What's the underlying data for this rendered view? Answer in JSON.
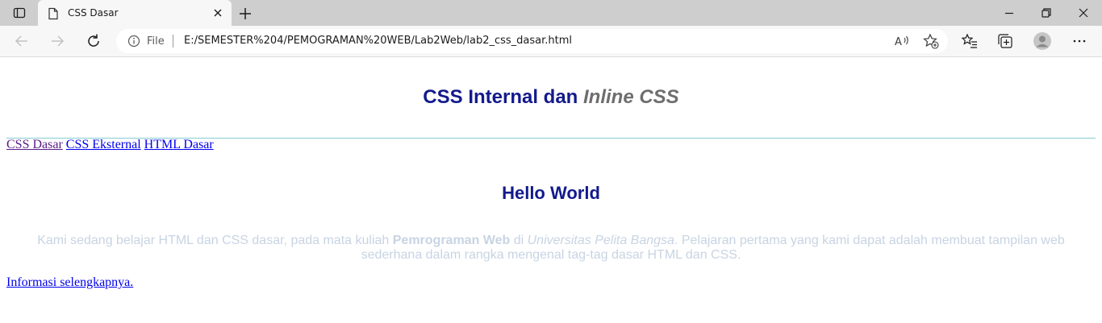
{
  "browser": {
    "tab_title": "CSS Dasar",
    "address_scheme_label": "File",
    "url": "E:/SEMESTER%204/PEMOGRAMAN%20WEB/Lab2Web/lab2_css_dasar.html",
    "icons": [
      "tab-actions-icon",
      "page-icon",
      "close-icon",
      "plus-icon",
      "minimize-icon",
      "restore-icon",
      "close-window-icon",
      "back-icon",
      "forward-icon",
      "reload-icon",
      "info-icon",
      "read-aloud-icon",
      "add-favorite-icon",
      "favorites-icon",
      "collections-icon",
      "profile-icon",
      "more-icon"
    ]
  },
  "page": {
    "heading_main": "CSS Internal dan ",
    "heading_emphasis": "Inline CSS",
    "nav": [
      {
        "label": "CSS Dasar",
        "state": "visited"
      },
      {
        "label": "CSS Eksternal",
        "state": "link"
      },
      {
        "label": "HTML Dasar",
        "state": "link"
      }
    ],
    "hello": "Hello World",
    "paragraph": {
      "part1": "Kami sedang belajar HTML dan CSS dasar, pada mata kuliah ",
      "bold": "Pemrograman Web",
      "part2": " di ",
      "italic": "Universitas Pelita Bangsa",
      "part3": ". Pelajaran pertama yang kami dapat adalah membuat tampilan web sederhana dalam rangka mengenal tag-tag dasar HTML dan CSS."
    },
    "more_link": "Informasi selengkapnya."
  },
  "colors": {
    "heading": "#131a8c",
    "heading_emphasis": "#6e6e6e",
    "hr": "#86cdd3",
    "visited_link": "#5a1a8a",
    "link": "#0000ee",
    "paragraph": "#c8d4e3"
  }
}
